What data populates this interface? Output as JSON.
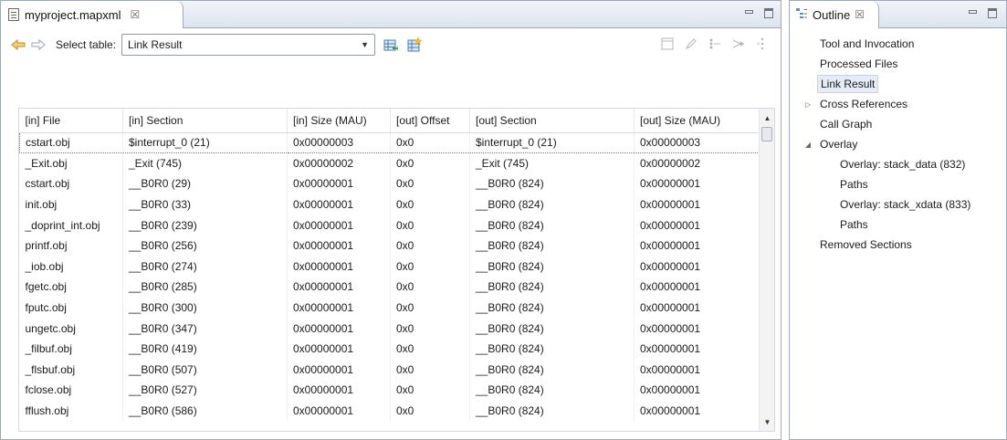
{
  "editor": {
    "tab_title": "myproject.mapxml",
    "tab_close": "☒",
    "select_label": "Select table:",
    "select_value": "Link Result"
  },
  "table": {
    "columns": [
      "[in] File",
      "[in] Section",
      "[in] Size (MAU)",
      "[out] Offset",
      "[out] Section",
      "[out] Size (MAU)"
    ],
    "rows": [
      [
        "cstart.obj",
        "$interrupt_0 (21)",
        "0x00000003",
        "0x0",
        "$interrupt_0 (21)",
        "0x00000003"
      ],
      [
        "_Exit.obj",
        "_Exit (745)",
        "0x00000002",
        "0x0",
        "_Exit (745)",
        "0x00000002"
      ],
      [
        "cstart.obj",
        "__B0R0 (29)",
        "0x00000001",
        "0x0",
        "__B0R0 (824)",
        "0x00000001"
      ],
      [
        "init.obj",
        "__B0R0 (33)",
        "0x00000001",
        "0x0",
        "__B0R0 (824)",
        "0x00000001"
      ],
      [
        "_doprint_int.obj",
        "__B0R0 (239)",
        "0x00000001",
        "0x0",
        "__B0R0 (824)",
        "0x00000001"
      ],
      [
        "printf.obj",
        "__B0R0 (256)",
        "0x00000001",
        "0x0",
        "__B0R0 (824)",
        "0x00000001"
      ],
      [
        "_iob.obj",
        "__B0R0 (274)",
        "0x00000001",
        "0x0",
        "__B0R0 (824)",
        "0x00000001"
      ],
      [
        "fgetc.obj",
        "__B0R0 (285)",
        "0x00000001",
        "0x0",
        "__B0R0 (824)",
        "0x00000001"
      ],
      [
        "fputc.obj",
        "__B0R0 (300)",
        "0x00000001",
        "0x0",
        "__B0R0 (824)",
        "0x00000001"
      ],
      [
        "ungetc.obj",
        "__B0R0 (347)",
        "0x00000001",
        "0x0",
        "__B0R0 (824)",
        "0x00000001"
      ],
      [
        "_filbuf.obj",
        "__B0R0 (419)",
        "0x00000001",
        "0x0",
        "__B0R0 (824)",
        "0x00000001"
      ],
      [
        "_flsbuf.obj",
        "__B0R0 (507)",
        "0x00000001",
        "0x0",
        "__B0R0 (824)",
        "0x00000001"
      ],
      [
        "fclose.obj",
        "__B0R0 (527)",
        "0x00000001",
        "0x0",
        "__B0R0 (824)",
        "0x00000001"
      ],
      [
        "fflush.obj",
        "__B0R0 (586)",
        "0x00000001",
        "0x0",
        "__B0R0 (824)",
        "0x00000001"
      ]
    ]
  },
  "outline": {
    "tab_title": "Outline",
    "tab_close": "☒",
    "items": [
      {
        "label": "Tool and Invocation",
        "level": 0,
        "twisty": ""
      },
      {
        "label": "Processed Files",
        "level": 0,
        "twisty": ""
      },
      {
        "label": "Link Result",
        "level": 0,
        "twisty": "",
        "active": true
      },
      {
        "label": "Cross References",
        "level": 0,
        "twisty": "▷"
      },
      {
        "label": "Call Graph",
        "level": 0,
        "twisty": ""
      },
      {
        "label": "Overlay",
        "level": 0,
        "twisty": "◢"
      },
      {
        "label": "Overlay: stack_data (832)",
        "level": 1,
        "twisty": ""
      },
      {
        "label": "Paths",
        "level": 1,
        "twisty": ""
      },
      {
        "label": "Overlay: stack_xdata (833)",
        "level": 1,
        "twisty": ""
      },
      {
        "label": "Paths",
        "level": 1,
        "twisty": ""
      },
      {
        "label": "Removed Sections",
        "level": 0,
        "twisty": ""
      }
    ]
  },
  "icons": {
    "back": "back-arrow-icon",
    "forward": "forward-arrow-icon",
    "export": "export-table-icon",
    "new": "new-table-icon"
  },
  "colors": {
    "accent_arrow": "#e8a92a",
    "selection": "#e5ecf6",
    "border": "#a0a9b5"
  }
}
